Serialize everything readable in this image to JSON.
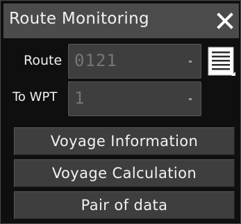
{
  "window": {
    "title": "Route Monitoring",
    "close_icon": "close-icon"
  },
  "route": {
    "label": "Route",
    "value": "0121",
    "list_icon": "list-icon"
  },
  "to_wpt": {
    "label": "To WPT",
    "value": "1"
  },
  "buttons": {
    "voyage_information": "Voyage Information",
    "voyage_calculation": "Voyage Calculation",
    "pair_of_data": "Pair of data"
  },
  "colors": {
    "panel_bg": "#0f0f0f",
    "titlebar_bg": "#4b4b4b",
    "control_bg": "#3e3e3e",
    "disabled_text": "#767676",
    "text": "#f2f2f2"
  }
}
